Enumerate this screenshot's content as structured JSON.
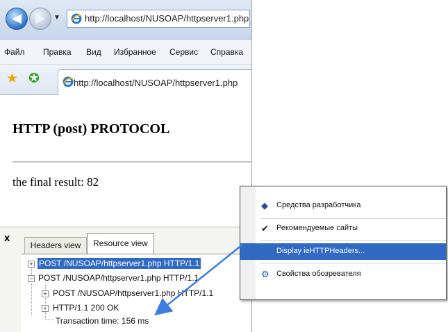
{
  "browser": {
    "address_url": "http://localhost/NUSOAP/httpserver1.php",
    "menu": [
      "Файл",
      "Правка",
      "Вид",
      "Избранное",
      "Сервис",
      "Справка"
    ],
    "tab_title": "http://localhost/NUSOAP/httpserver1.php"
  },
  "page": {
    "title": "HTTP (post) PROTOCOL",
    "result_text": "the final result: 82"
  },
  "explorer_bar": {
    "close_label": "x",
    "tabs": [
      "Headers view",
      "Resource view"
    ],
    "active_tab": "Resource view",
    "tree": [
      {
        "text": "POST /NUSOAP/httpserver1.php HTTP/1.1",
        "expander": "+",
        "selected": true
      },
      {
        "text": "POST /NUSOAP/httpserver1.php HTTP/1.1",
        "expander": "−",
        "selected": false
      },
      {
        "text": "POST /NUSOAP/httpserver1.php HTTP/1.1",
        "expander": "+",
        "selected": false
      },
      {
        "text": "HTTP/1.1 200 OK",
        "expander": "+",
        "selected": false
      },
      {
        "text": "Transaction time: 156 ms",
        "expander": "",
        "selected": false
      }
    ]
  },
  "context_menu": {
    "items": [
      {
        "label": "Средства разработчика",
        "icon": "developer-tools-icon",
        "highlighted": false
      },
      {
        "label": "Рекомендуемые сайты",
        "icon": "checkmark-icon",
        "highlighted": false
      },
      {
        "label": "Display ieHTTPHeaders...",
        "icon": "",
        "highlighted": true
      },
      {
        "label": "Свойства обозревателя",
        "icon": "internet-options-icon",
        "highlighted": false
      }
    ]
  },
  "colors": {
    "selection": "#316ac5",
    "arrow": "#3b7de0"
  }
}
